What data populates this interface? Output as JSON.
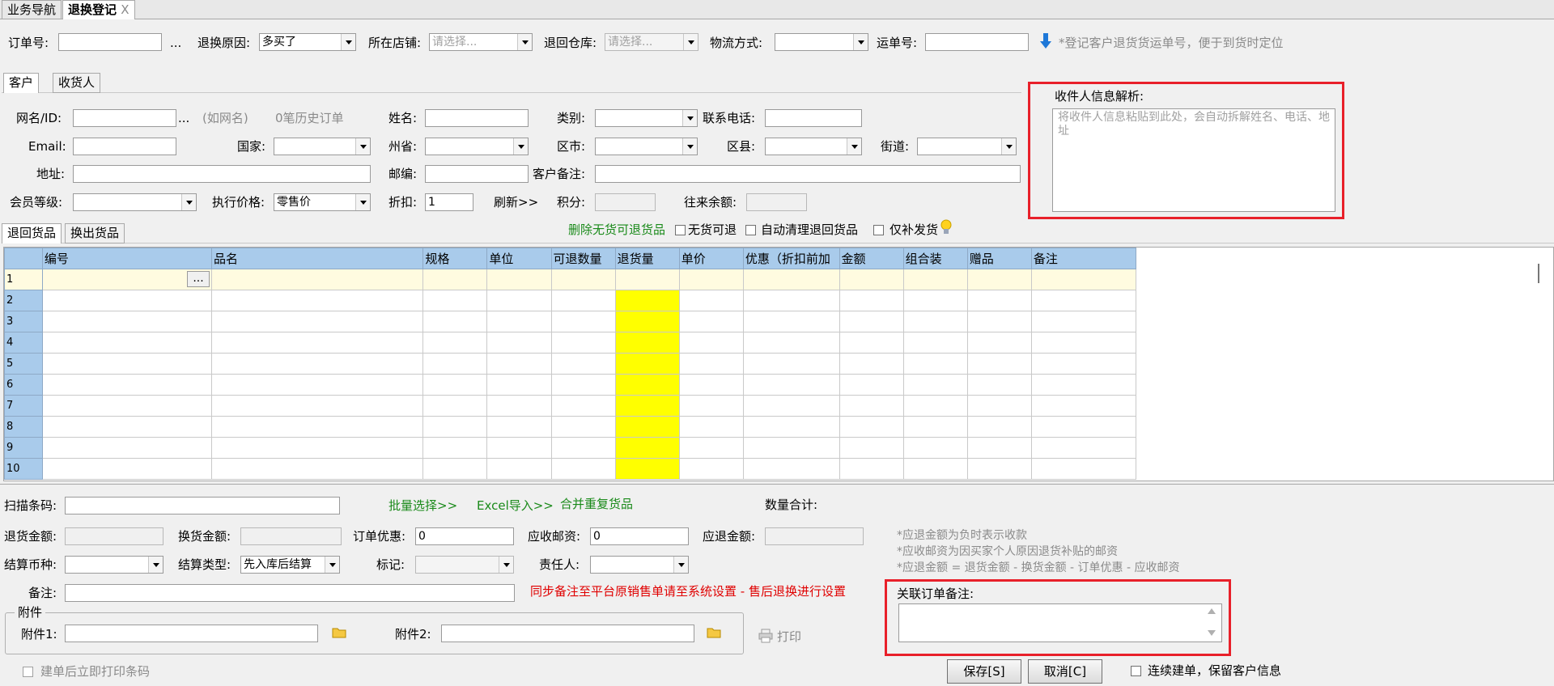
{
  "tabs": {
    "nav": "业务导航",
    "active": "退换登记",
    "close": "X"
  },
  "top": {
    "order_no_label": "订单号:",
    "ellipsis": "...",
    "reason_label": "退换原因:",
    "reason_value": "多买了",
    "store_label": "所在店铺:",
    "store_placeholder": "请选择...",
    "warehouse_label": "退回仓库:",
    "warehouse_placeholder": "请选择...",
    "logistics_label": "物流方式:",
    "waybill_label": "运单号:",
    "waybill_hint": "*登记客户退货货运单号，便于到货时定位"
  },
  "cust_tabs": [
    "客户",
    "收货人"
  ],
  "cust": {
    "netname_label": "网名/ID:",
    "ellipsis": "...",
    "netname_hint": "(如网名)",
    "history": "0笔历史订单",
    "name_label": "姓名:",
    "category_label": "类别:",
    "phone_label": "联系电话:",
    "email_label": "Email:",
    "country_label": "国家:",
    "province_label": "州省:",
    "city_label": "区市:",
    "district_label": "区县:",
    "street_label": "街道:",
    "address_label": "地址:",
    "zip_label": "邮编:",
    "remark_label": "客户备注:",
    "level_label": "会员等级:",
    "price_label": "执行价格:",
    "price_value": "零售价",
    "discount_label": "折扣:",
    "discount_value": "1",
    "refresh": "刷新>>",
    "points_label": "积分:",
    "balance_label": "往来余额:"
  },
  "parse": {
    "title": "收件人信息解析:",
    "placeholder": "将收件人信息粘贴到此处，会自动拆解姓名、电话、地址"
  },
  "goods_tabs": [
    "退回货品",
    "换出货品"
  ],
  "goods_opts": {
    "delete_link": "删除无货可退货品",
    "no_stock": "无货可退",
    "auto_clear": "自动清理退回货品",
    "only_supply": "仅补发货"
  },
  "grid": {
    "columns": [
      "编号",
      "品名",
      "规格",
      "单位",
      "可退数量",
      "退货量",
      "单价",
      "优惠（折扣前加",
      "金额",
      "组合装",
      "赠品",
      "备注"
    ],
    "rows": [
      "1",
      "2",
      "3",
      "4",
      "5",
      "6",
      "7",
      "8",
      "9",
      "10"
    ],
    "first_cell_btn": "..."
  },
  "bottom": {
    "scan_label": "扫描条码:",
    "batch": "批量选择>>",
    "excel": "Excel导入>>",
    "merge": "合并重复货品",
    "qty_total_label": "数量合计:",
    "return_amt_label": "退货金额:",
    "exchange_amt_label": "换货金额:",
    "order_disc_label": "订单优惠:",
    "order_disc_value": "0",
    "postage_label": "应收邮资:",
    "postage_value": "0",
    "refund_label": "应退金额:",
    "currency_label": "结算币种:",
    "settle_type_label": "结算类型:",
    "settle_type_value": "先入库后结算",
    "mark_label": "标记:",
    "owner_label": "责任人:",
    "remark_label": "备注:",
    "sync_note": "同步备注至平台原销售单请至系统设置 - 售后退换进行设置",
    "notes": [
      "*应退金额为负时表示收款",
      "*应收邮资为因买家个人原因退货补贴的邮资",
      "*应退金额 = 退货金额 - 换货金额 - 订单优惠 - 应收邮资"
    ],
    "attach_legend": "附件",
    "attach1_label": "附件1:",
    "attach2_label": "附件2:",
    "print": "打印",
    "assoc_remark_label": "关联订单备注:",
    "print_barcode": "建单后立即打印条码",
    "save": "保存[S]",
    "cancel": "取消[C]",
    "continue": "连续建单，保留客户信息"
  },
  "colors": {
    "header": "#a9cbeb",
    "highlight": "#ffff00",
    "red_box": "#e8202a",
    "link_green": "#1a8a1a"
  }
}
